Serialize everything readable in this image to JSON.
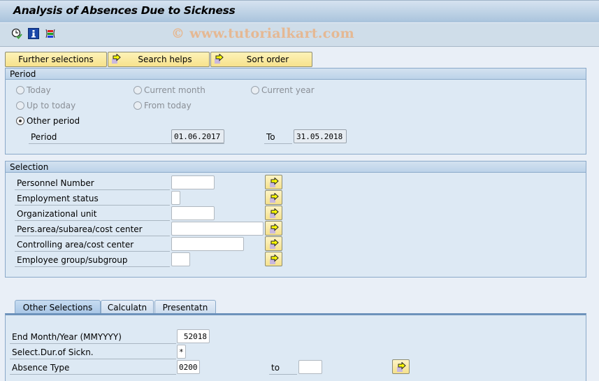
{
  "window": {
    "title": "Analysis of Absences Due to Sickness",
    "watermark": "© www.tutorialkart.com"
  },
  "toolbar": {
    "icons": [
      {
        "name": "execute-clock-icon",
        "label": "Execute"
      },
      {
        "name": "info-icon",
        "label": "Information"
      },
      {
        "name": "selection-options-icon",
        "label": "Selection options"
      }
    ]
  },
  "selection_buttons": {
    "further_selections": "Further selections",
    "search_helps": "Search helps",
    "sort_order": "Sort order"
  },
  "period": {
    "title": "Period",
    "options": {
      "today": "Today",
      "current_month": "Current month",
      "current_year": "Current year",
      "up_to_today": "Up to today",
      "from_today": "From today",
      "other_period": "Other period"
    },
    "selected": "other_period",
    "period_label": "Period",
    "from_value": "01.06.2017",
    "to_label": "To",
    "to_value": "31.05.2018"
  },
  "selection": {
    "title": "Selection",
    "fields": [
      {
        "label": "Personnel Number",
        "value": ""
      },
      {
        "label": "Employment status",
        "value": ""
      },
      {
        "label": "Organizational unit",
        "value": ""
      },
      {
        "label": "Pers.area/subarea/cost center",
        "value": ""
      },
      {
        "label": "Controlling area/cost center",
        "value": ""
      },
      {
        "label": "Employee group/subgroup",
        "value": ""
      }
    ]
  },
  "tabs": {
    "items": [
      "Other Selections",
      "Calculatn",
      "Presentatn"
    ],
    "active": "Other Selections"
  },
  "other_selections": {
    "end_month_year": {
      "label": "End Month/Year (MMYYYY)",
      "value": "52018"
    },
    "duration_sickness": {
      "label": "Select.Dur.of Sickn.",
      "value": "*"
    },
    "absence_type": {
      "label": "Absence Type",
      "from_value": "0200",
      "to_label": "to",
      "to_value": ""
    }
  }
}
